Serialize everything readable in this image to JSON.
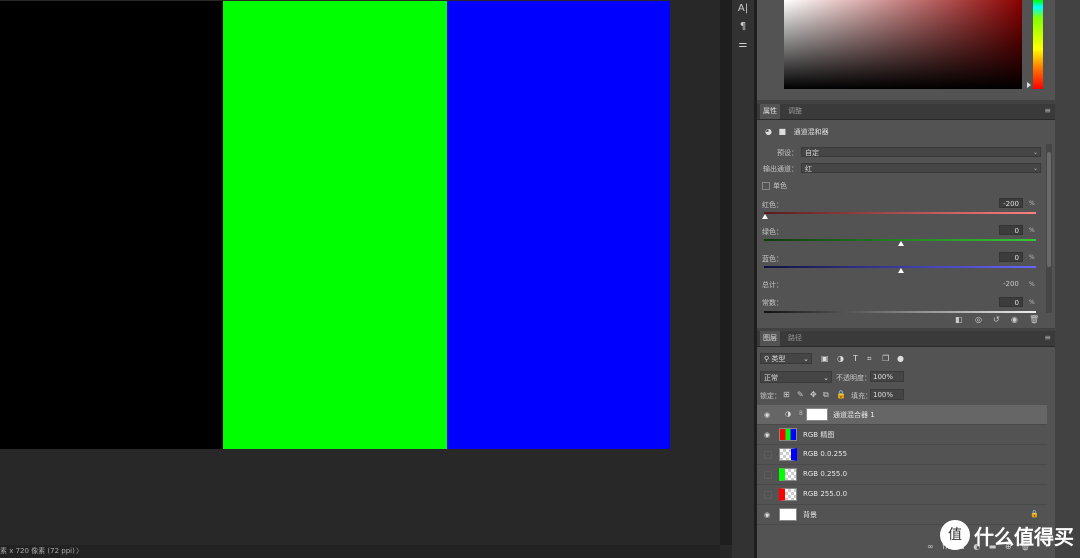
{
  "canvas": {
    "stripes": [
      {
        "name": "black",
        "color": "#000000"
      },
      {
        "name": "green",
        "color": "#00ff00"
      },
      {
        "name": "blue",
        "color": "#0000ff"
      }
    ]
  },
  "status_bar": {
    "doc_info": "素 x 720 像素 (72 ppi)",
    "arrow": "〉"
  },
  "tools": [
    {
      "icon": "character-icon",
      "glyph": "A|"
    },
    {
      "icon": "paragraph-icon",
      "glyph": "¶"
    },
    {
      "icon": "adjust-icon",
      "glyph": "⚌"
    }
  ],
  "properties": {
    "tabs": [
      {
        "label": "属性",
        "active": true
      },
      {
        "label": "调整",
        "active": false
      }
    ],
    "title": "通道混和器",
    "preset_label": "预设：",
    "preset_value": "自定",
    "output_label": "输出通道：",
    "output_value": "红",
    "mono_label": "单色",
    "channels": [
      {
        "label": "红色：",
        "value": "-200",
        "color_from": "#5a1a1a",
        "color_to": "#ff8080",
        "fraction": 0.0
      },
      {
        "label": "绿色：",
        "value": "0",
        "color_from": "#0f3a0f",
        "color_to": "#33cc33",
        "fraction": 0.5
      },
      {
        "label": "蓝色：",
        "value": "0",
        "color_from": "#101040",
        "color_to": "#6666ff",
        "fraction": 0.5
      }
    ],
    "total_label": "总计：",
    "total_value": "-200",
    "const_label": "常数：",
    "const_value": "0",
    "pct": "%"
  },
  "layers": {
    "tabs": [
      {
        "label": "图层",
        "active": true
      },
      {
        "label": "路径",
        "active": false
      }
    ],
    "kind_label": "类型",
    "blend_mode": "正常",
    "opacity_label": "不透明度：",
    "opacity_value": "100%",
    "lock_label": "锁定：",
    "fill_label": "填充：",
    "fill_value": "100%",
    "items": [
      {
        "name": "通道混合器 1",
        "visible": true,
        "selected": true,
        "type": "adjustment"
      },
      {
        "name": "RGB 精图",
        "visible": true,
        "selected": false,
        "type": "rgb"
      },
      {
        "name": "RGB 0.0.255",
        "visible": false,
        "selected": false,
        "type": "blue"
      },
      {
        "name": "RGB 0.255.0",
        "visible": false,
        "selected": false,
        "type": "green"
      },
      {
        "name": "RGB 255.0.0",
        "visible": false,
        "selected": false,
        "type": "red"
      },
      {
        "name": "背景",
        "visible": true,
        "selected": false,
        "type": "background"
      }
    ]
  },
  "watermark": {
    "logo": "值",
    "text": "什么值得买"
  }
}
